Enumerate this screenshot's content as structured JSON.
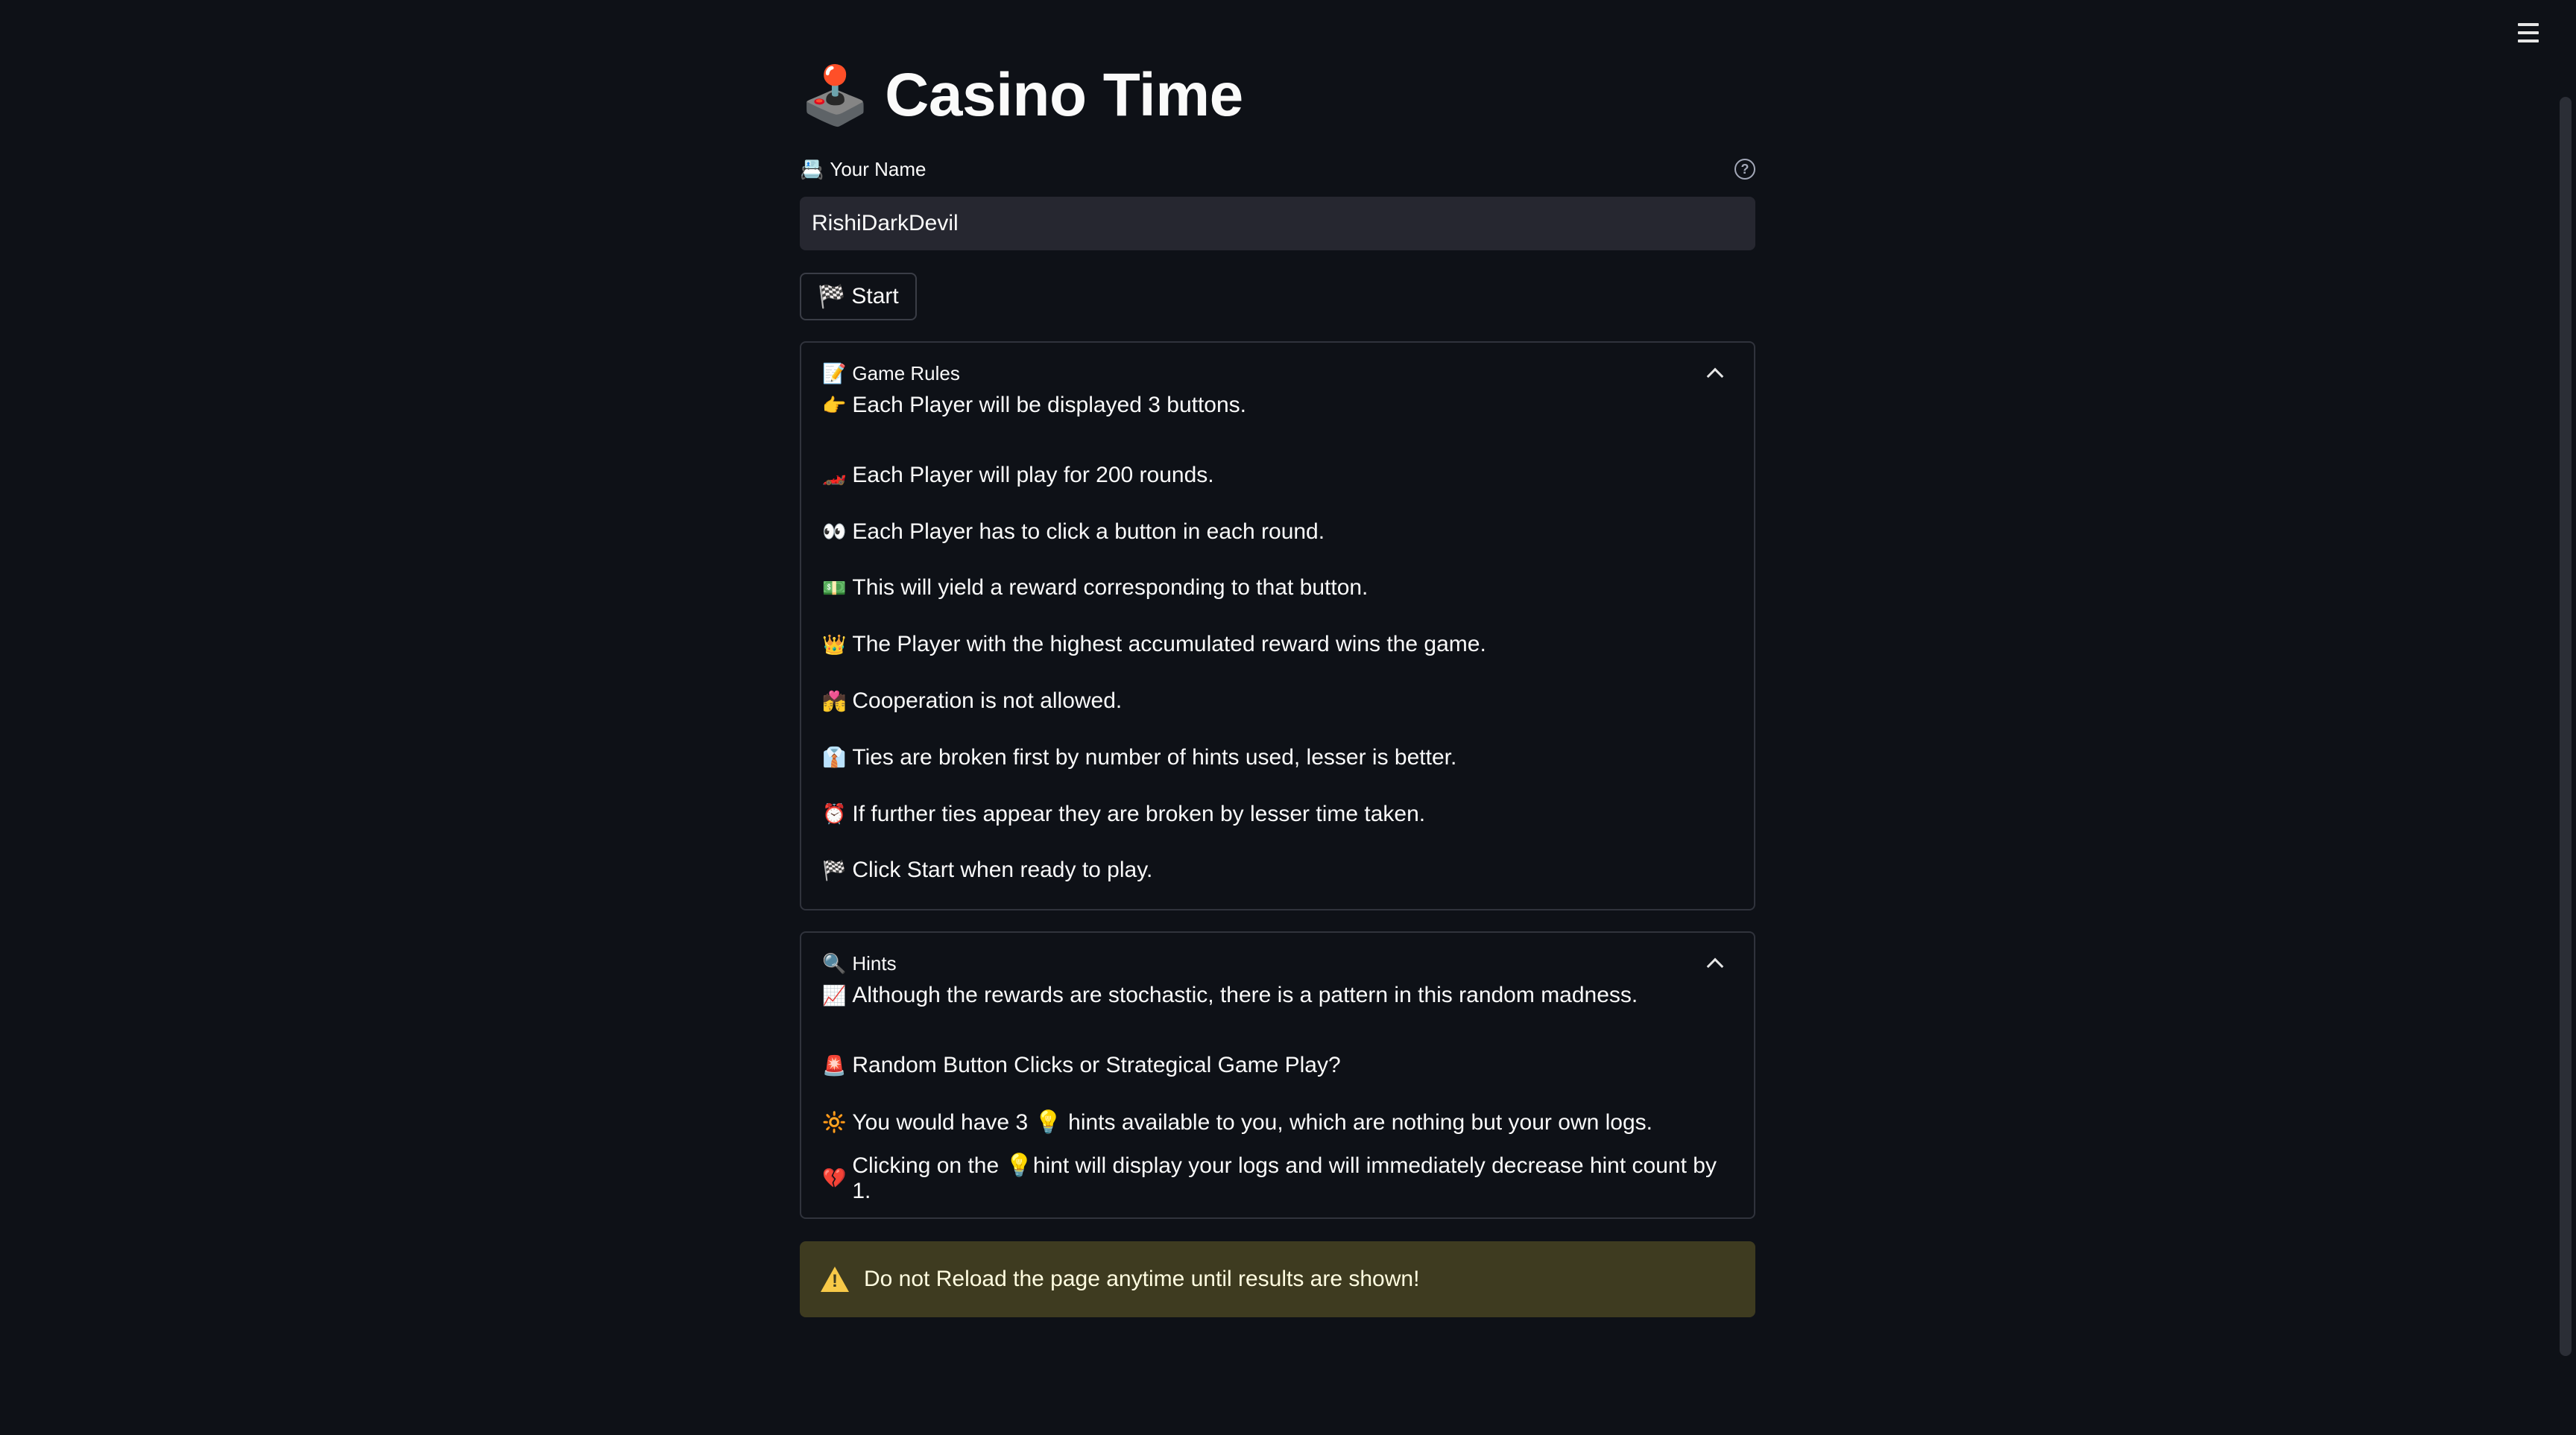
{
  "header": {
    "title_emoji": "🕹️",
    "title": "Casino Time"
  },
  "name_field": {
    "label_emoji": "📇",
    "label": "Your Name",
    "value": "RishiDarkDevil"
  },
  "start_button": {
    "emoji": "🏁",
    "label": "Start"
  },
  "game_rules": {
    "emoji": "📝",
    "title": "Game Rules",
    "items": [
      {
        "icon": "👉",
        "text": "Each Player will be displayed 3 buttons."
      },
      {
        "icon": "🏎️",
        "text": "Each Player will play for 200 rounds."
      },
      {
        "icon": "👀",
        "text": "Each Player has to click a button in each round."
      },
      {
        "icon": "💵",
        "text": "This will yield a reward corresponding to that button."
      },
      {
        "icon": "👑",
        "text": "The Player with the highest accumulated reward wins the game."
      },
      {
        "icon": "💏",
        "text": "Cooperation is not allowed."
      },
      {
        "icon": "👔",
        "text": "Ties are broken first by number of hints used, lesser is better."
      },
      {
        "icon": "⏰",
        "text": "If further ties appear they are broken by lesser time taken."
      },
      {
        "icon": "🏁",
        "text": "Click Start when ready to play."
      }
    ]
  },
  "hints": {
    "emoji": "🔍",
    "title": "Hints",
    "items": [
      {
        "icon": "📈",
        "text": "Although the rewards are stochastic, there is a pattern in this random madness."
      },
      {
        "icon": "🚨",
        "text": "Random Button Clicks or Strategical Game Play?"
      },
      {
        "icon": "🔆",
        "text": "You would have 3 💡 hints available to you, which are nothing but your own logs."
      },
      {
        "icon": "💔",
        "text": "Clicking on the 💡hint will display your logs and will immediately decrease hint count by 1."
      }
    ]
  },
  "warning": {
    "text": "Do not Reload the page anytime until results are shown!"
  }
}
